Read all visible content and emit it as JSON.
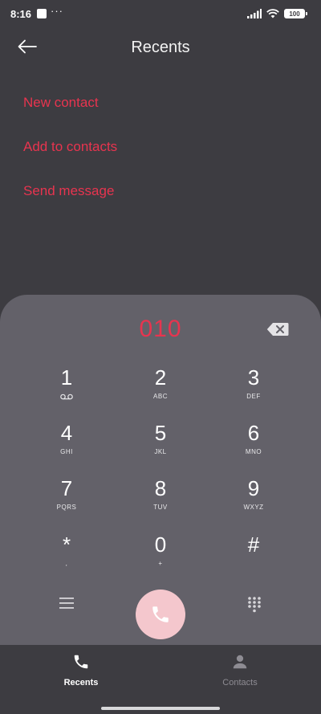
{
  "status_bar": {
    "time": "8:16",
    "dots": "···",
    "battery": "100"
  },
  "header": {
    "title": "Recents"
  },
  "actions": [
    {
      "label": "New contact"
    },
    {
      "label": "Add to contacts"
    },
    {
      "label": "Send message"
    }
  ],
  "dialpad": {
    "entered_number": "010",
    "keys": [
      {
        "digit": "1",
        "letters": ""
      },
      {
        "digit": "2",
        "letters": "ABC"
      },
      {
        "digit": "3",
        "letters": "DEF"
      },
      {
        "digit": "4",
        "letters": "GHI"
      },
      {
        "digit": "5",
        "letters": "JKL"
      },
      {
        "digit": "6",
        "letters": "MNO"
      },
      {
        "digit": "7",
        "letters": "PQRS"
      },
      {
        "digit": "8",
        "letters": "TUV"
      },
      {
        "digit": "9",
        "letters": "WXYZ"
      },
      {
        "digit": "*",
        "letters": ","
      },
      {
        "digit": "0",
        "letters": "+"
      },
      {
        "digit": "#",
        "letters": ""
      }
    ]
  },
  "bottom_nav": {
    "tabs": [
      {
        "label": "Recents",
        "icon": "phone-icon",
        "active": true
      },
      {
        "label": "Contacts",
        "icon": "person-icon",
        "active": false
      }
    ]
  },
  "colors": {
    "background": "#3d3c41",
    "dialpad": "#636169",
    "accent": "#e8344f",
    "call_button": "#f4c7cd"
  }
}
